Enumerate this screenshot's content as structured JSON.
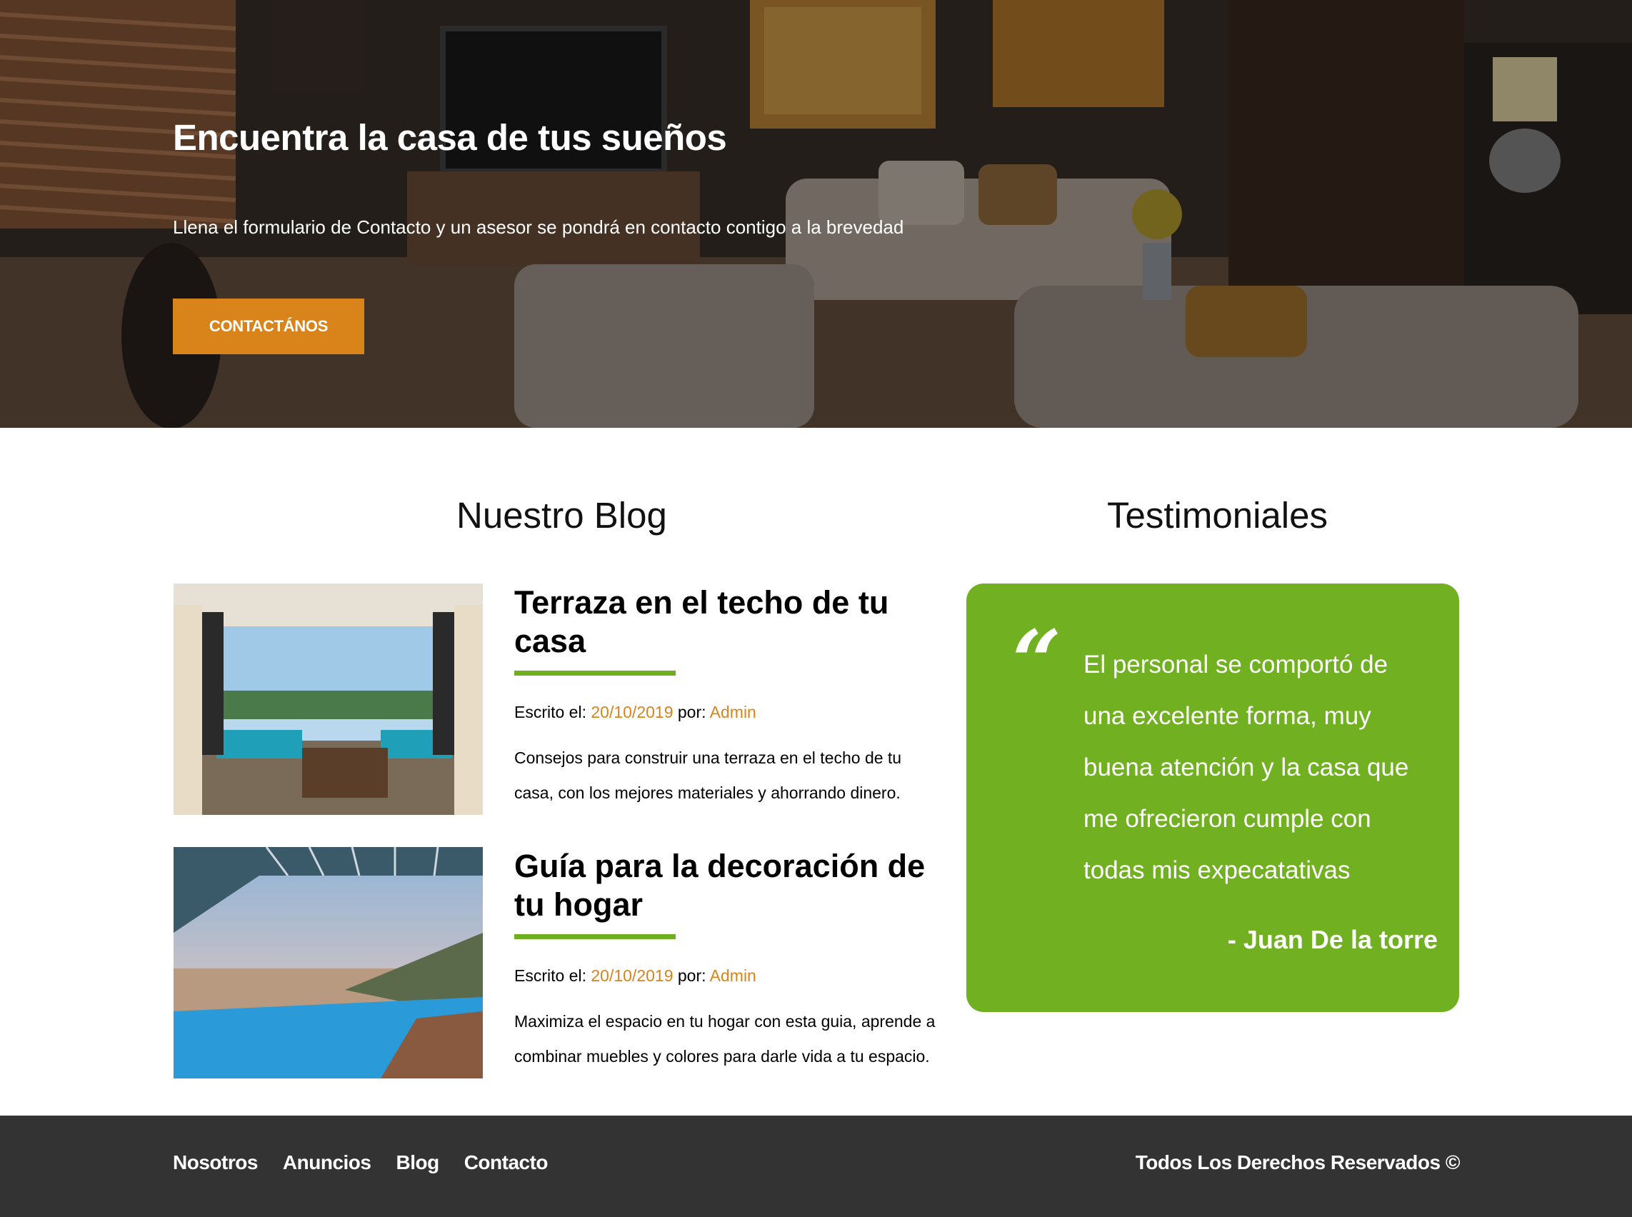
{
  "hero": {
    "title": "Encuentra la casa de tus sueños",
    "subtitle": "Llena el formulario de Contacto y un asesor se pondrá en contacto contigo a la brevedad",
    "button_label": "CONTACTÁNOS"
  },
  "blog": {
    "section_title": "Nuestro Blog",
    "posts": [
      {
        "title": "Terraza en el techo de tu casa",
        "meta_prefix": "Escrito el: ",
        "date": "20/10/2019",
        "meta_by": " por: ",
        "author": "Admin",
        "excerpt": "Consejos para construir una terraza en el techo de tu casa, con los mejores materiales y ahorrando dinero."
      },
      {
        "title": "Guía para la decoración de tu hogar",
        "meta_prefix": "Escrito el: ",
        "date": "20/10/2019",
        "meta_by": " por: ",
        "author": "Admin",
        "excerpt": "Maximiza el espacio en tu hogar con esta guia, aprende a combinar muebles y colores para darle vida a tu espacio."
      }
    ]
  },
  "testimonials": {
    "section_title": "Testimoniales",
    "quote_mark": "“",
    "text": "El personal se comportó de una excelente forma, muy buena atención y la casa que me ofrecieron cumple con todas mis expecatativas",
    "author": "- Juan De la torre"
  },
  "footer": {
    "nav": [
      "Nosotros",
      "Anuncios",
      "Blog",
      "Contacto"
    ],
    "copyright": "Todos Los Derechos Reservados ©"
  },
  "colors": {
    "accent_orange": "#d9841b",
    "accent_green": "#70b021",
    "footer_bg": "#333333"
  }
}
